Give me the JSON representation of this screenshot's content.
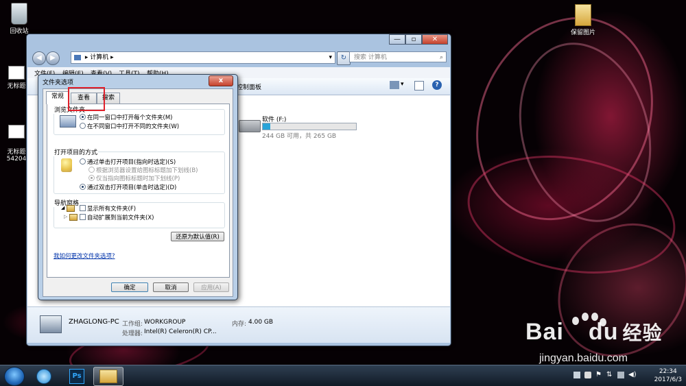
{
  "desktop": {
    "icons": [
      {
        "label": "回收站"
      },
      {
        "label": "无标题"
      },
      {
        "label": "无标题\n54204"
      },
      {
        "label": "保留图片"
      }
    ]
  },
  "explorer": {
    "breadcrumb": "计算机",
    "search_placeholder": "搜索 计算机",
    "menu": [
      "文件(F)",
      "编辑(E)",
      "查看(V)",
      "工具(T)",
      "帮助(H)"
    ],
    "toolbar": {
      "control_panel": "控制面板"
    },
    "drive": {
      "name": "软件 (F:)",
      "space": "244 GB 可用，共 265 GB",
      "used_fraction": 0.08
    },
    "details": {
      "computer_name": "ZHAGLONG-PC",
      "workgroup_label": "工作组:",
      "workgroup": "WORKGROUP",
      "memory_label": "内存:",
      "memory": "4.00 GB",
      "cpu_label": "处理器:",
      "cpu": "Intel(R) Celeron(R) CP..."
    }
  },
  "dialog": {
    "title": "文件夹选项",
    "close": "x",
    "tabs": [
      "常规",
      "查看",
      "搜索"
    ],
    "browse": {
      "title": "浏览文件夹",
      "opt1": "在同一窗口中打开每个文件夹(M)",
      "opt2": "在不同窗口中打开不同的文件夹(W)"
    },
    "open": {
      "title": "打开项目的方式",
      "opt1": "通过单击打开项目(指向时选定)(S)",
      "opt1a": "根据浏览器设置给图标标题加下划线(B)",
      "opt1b": "仅当指向图标标题时加下划线(P)",
      "opt2": "通过双击打开项目(单击时选定)(D)"
    },
    "nav": {
      "title": "导航窗格",
      "chk1": "显示所有文件夹(F)",
      "chk2": "自动扩展到当前文件夹(X)"
    },
    "restore": "还原为默认值(R)",
    "help": "我如何更改文件夹选项?",
    "ok": "确定",
    "cancel": "取消",
    "apply": "应用(A)"
  },
  "taskbar": {
    "time": "22:34",
    "date": "2017/6/3",
    "ps_label": "Ps"
  },
  "watermark": {
    "brand": "Bai",
    "brand2": "du",
    "brand_cn": "经验",
    "url": "jingyan.baidu.com"
  },
  "colors": {
    "highlight": "#e0202a",
    "link": "#0033aa",
    "drive_bar": "#2aa4d8"
  }
}
